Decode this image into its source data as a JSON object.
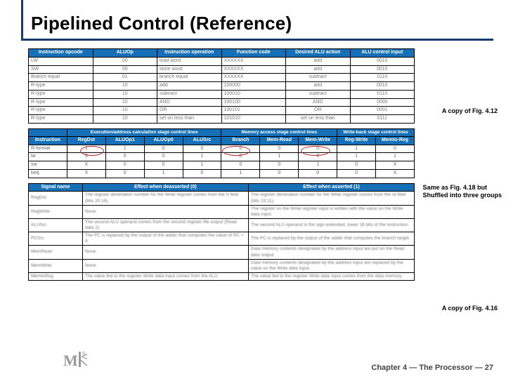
{
  "title": "Pipelined Control (Reference)",
  "notes": {
    "n1": "A copy of Fig. 4.12",
    "n2a": "Same as Fig. 4.18 but",
    "n2b": "Shuffled into three groups",
    "n3": "A copy of Fig. 4.16"
  },
  "footer": "Chapter 4 — The Processor — 27",
  "t1": {
    "head": [
      "Instruction opcode",
      "ALUOp",
      "Instruction operation",
      "Function code",
      "Desired ALU action",
      "ALU control input"
    ],
    "rows": [
      [
        "LW",
        "00",
        "load word",
        "XXXXXX",
        "add",
        "0010"
      ],
      [
        "SW",
        "00",
        "store word",
        "XXXXXX",
        "add",
        "0010"
      ],
      [
        "Branch equal",
        "01",
        "branch equal",
        "XXXXXX",
        "subtract",
        "0110"
      ],
      [
        "R-type",
        "10",
        "add",
        "100000",
        "add",
        "0010"
      ],
      [
        "R-type",
        "10",
        "subtract",
        "100010",
        "subtract",
        "0110"
      ],
      [
        "R-type",
        "10",
        "AND",
        "100100",
        "AND",
        "0000"
      ],
      [
        "R-type",
        "10",
        "OR",
        "100101",
        "OR",
        "0001"
      ],
      [
        "R-type",
        "10",
        "set on less than",
        "101010",
        "set on less than",
        "0111"
      ]
    ]
  },
  "t2": {
    "grp": [
      "",
      "Execution/address calculation stage control lines",
      "Memory access stage control lines",
      "Write-back stage control lines"
    ],
    "head": [
      "Instruction",
      "RegDst",
      "ALUOp1",
      "ALUOp0",
      "ALUSrc",
      "Branch",
      "Mem-Read",
      "Mem-Write",
      "Reg-Write",
      "Memto-Reg"
    ],
    "rows": [
      [
        "R-format",
        "1",
        "1",
        "0",
        "0",
        "0",
        "0",
        "0",
        "1",
        "0"
      ],
      [
        "lw",
        "0",
        "0",
        "0",
        "1",
        "0",
        "1",
        "0",
        "1",
        "1"
      ],
      [
        "sw",
        "X",
        "0",
        "0",
        "1",
        "0",
        "0",
        "1",
        "0",
        "X"
      ],
      [
        "beq",
        "X",
        "0",
        "1",
        "0",
        "1",
        "0",
        "0",
        "0",
        "X"
      ]
    ]
  },
  "t3": {
    "head": [
      "Signal name",
      "Effect when deasserted (0)",
      "Effect when asserted (1)"
    ],
    "rows": [
      [
        "RegDst",
        "The register destination number for the Write register comes from the rt field (bits 20:16).",
        "The register destination number for the Write register comes from the rd field (bits 15:11)."
      ],
      [
        "RegWrite",
        "None.",
        "The register on the Write register input is written with the value on the Write data input."
      ],
      [
        "ALUSrc",
        "The second ALU operand comes from the second register file output (Read data 2).",
        "The second ALU operand is the sign-extended, lower 16 bits of the instruction."
      ],
      [
        "PCSrc",
        "The PC is replaced by the output of the adder that computes the value of PC + 4.",
        "The PC is replaced by the output of the adder that computes the branch target."
      ],
      [
        "MemRead",
        "None.",
        "Data memory contents designated by the address input are put on the Read data output."
      ],
      [
        "MemWrite",
        "None.",
        "Data memory contents designated by the address input are replaced by the value on the Write data input."
      ],
      [
        "MemtoReg",
        "The value fed to the register Write data input comes from the ALU.",
        "The value fed to the register Write data input comes from the data memory."
      ]
    ]
  }
}
